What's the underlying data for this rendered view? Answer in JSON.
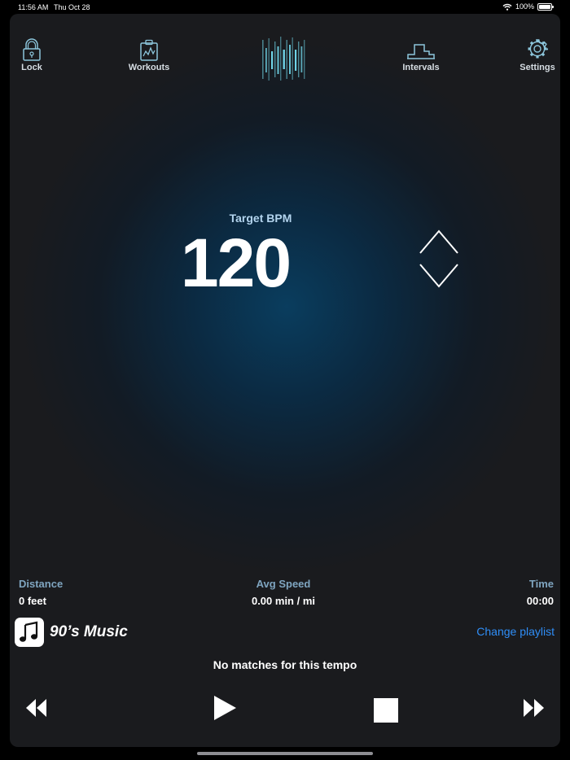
{
  "status_bar": {
    "time": "11:56 AM",
    "date": "Thu Oct 28",
    "battery": "100%"
  },
  "nav": {
    "lock": "Lock",
    "workouts": "Workouts",
    "intervals": "Intervals",
    "settings": "Settings"
  },
  "tempo": {
    "label": "Target BPM",
    "value": "120"
  },
  "stats": {
    "distance_label": "Distance",
    "distance_value": "0 feet",
    "speed_label": "Avg Speed",
    "speed_value": "0.00 min / mi",
    "time_label": "Time",
    "time_value": "00:00"
  },
  "playlist": {
    "name": "90’s Music",
    "change_label": "Change playlist"
  },
  "message": "No matches for this tempo",
  "icons": {
    "lock": "lock-icon",
    "workouts": "clipboard-chart-icon",
    "intervals": "steps-chart-icon",
    "settings": "gear-icon",
    "logo": "waveform-logo",
    "music": "music-note-icon"
  },
  "colors": {
    "accent": "#2f8ef7",
    "stat_label": "#7fa5c0",
    "target_label": "#b3d4ee",
    "logo": "#6fd3e6"
  }
}
